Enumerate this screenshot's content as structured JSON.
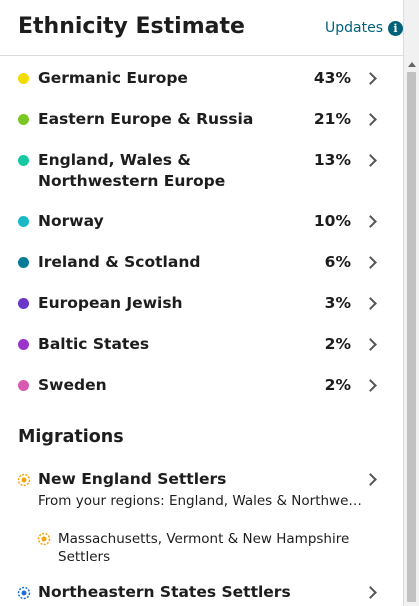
{
  "header": {
    "title": "Ethnicity Estimate",
    "updates_label": "Updates",
    "info_icon": "info-icon"
  },
  "ethnicities": [
    {
      "name": "Germanic Europe",
      "percent": "43%",
      "color": "#f2dc00"
    },
    {
      "name": "Eastern Europe & Russia",
      "percent": "21%",
      "color": "#7cc623"
    },
    {
      "name": "England, Wales & Northwestern Europe",
      "percent": "13%",
      "color": "#16c9a0"
    },
    {
      "name": "Norway",
      "percent": "10%",
      "color": "#1bb8c7"
    },
    {
      "name": "Ireland & Scotland",
      "percent": "6%",
      "color": "#0a7a99"
    },
    {
      "name": "European Jewish",
      "percent": "3%",
      "color": "#6a35c9"
    },
    {
      "name": "Baltic States",
      "percent": "2%",
      "color": "#9a35c9"
    },
    {
      "name": "Sweden",
      "percent": "2%",
      "color": "#d85ab0"
    }
  ],
  "migrations": {
    "title": "Migrations",
    "items": [
      {
        "name": "New England Settlers",
        "subtitle": "From your regions: England, Wales & Northwestern Europe",
        "color": "#f5a30a"
      },
      {
        "sub_name": "Massachusetts, Vermont & New Hampshire Settlers",
        "color": "#f5a30a"
      },
      {
        "name": "Northeastern States Settlers",
        "color": "#1a6fd6"
      }
    ]
  }
}
